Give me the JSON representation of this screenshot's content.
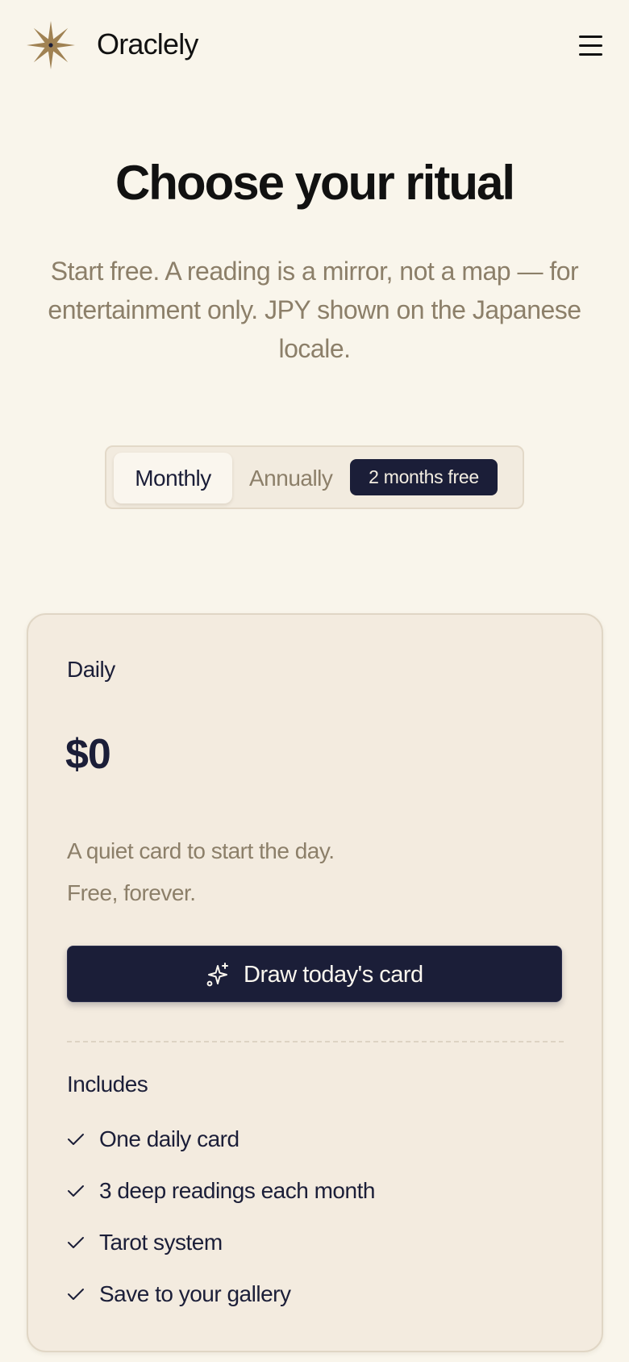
{
  "header": {
    "brand": "Oraclely",
    "logo_icon": "eight-point-star-icon",
    "menu_icon": "hamburger-menu-icon",
    "accent_color": "#a08253"
  },
  "hero": {
    "title": "Choose your ritual",
    "subtitle": "Start free. A reading is a mirror, not a map — for entertainment only. JPY shown on the Japanese locale."
  },
  "billing_toggle": {
    "monthly_label": "Monthly",
    "annually_label": "Annually",
    "badge": "2 months free",
    "selected": "Monthly"
  },
  "plan": {
    "name": "Daily",
    "price": "$0",
    "description_lines": [
      "A quiet card to start the day.",
      "Free, forever."
    ],
    "cta_label": "Draw today's card",
    "cta_icon": "sparkles-icon",
    "includes_title": "Includes",
    "features": [
      "One daily card",
      "3 deep readings each month",
      "Tarot system",
      "Save to your gallery"
    ],
    "feature_icon": "check-icon"
  },
  "colors": {
    "background": "#f9f5eb",
    "card": "#f3ebdf",
    "navy": "#1b1e38",
    "muted_text": "#8c7f69"
  }
}
